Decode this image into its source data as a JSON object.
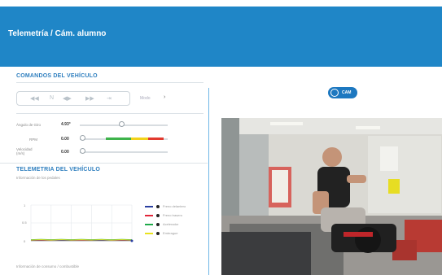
{
  "header": {
    "title": "Telemetría / Cám. alumno"
  },
  "commands": {
    "title": "COMANDOS DEL VEHÍCULO",
    "controls": [
      "◀◀",
      "N",
      "◀▶",
      "▶▶",
      "⇥"
    ],
    "mode_label": "Modo",
    "mode_arrow": "›",
    "rows": [
      {
        "label": "Ángulo de Giro",
        "value": "4.93°",
        "level": 0.48
      },
      {
        "label": "RPM",
        "value": "0.00",
        "level": 0.0
      },
      {
        "label": "Velocidad (m/s)",
        "value": "0.00",
        "level": 0.0
      }
    ],
    "rpm_bands": [
      {
        "color": "#3db34a",
        "from": 0.3,
        "to": 0.58
      },
      {
        "color": "#f2d21a",
        "from": 0.58,
        "to": 0.78
      },
      {
        "color": "#e23a2e",
        "from": 0.78,
        "to": 0.95
      }
    ]
  },
  "telemetry": {
    "title": "TELEMETRIA DEL VEHÍCULO",
    "subtitle": "Información de los pedales",
    "footer": "Información de consumo / combustible",
    "chart_data": {
      "type": "line",
      "title": "",
      "xlabel": "",
      "ylabel": "",
      "yticks": [
        "1",
        "0.5",
        "0"
      ],
      "ylim": [
        0,
        1
      ],
      "x": [
        0,
        1,
        2,
        3,
        4,
        5,
        6,
        7,
        8,
        9,
        10
      ],
      "series": [
        {
          "name": "Freno delantero",
          "color": "#2a3fa0",
          "values": [
            0.01,
            0.01,
            0.02,
            0.01,
            0.01,
            0.02,
            0.01,
            0.01,
            0.02,
            0.01,
            0.01
          ]
        },
        {
          "name": "Freno trasero",
          "color": "#e2263a",
          "values": [
            0.02,
            0.02,
            0.02,
            0.03,
            0.02,
            0.02,
            0.02,
            0.03,
            0.02,
            0.02,
            0.02
          ]
        },
        {
          "name": "Acelerador",
          "color": "#1faa4a",
          "values": [
            0.03,
            0.04,
            0.03,
            0.04,
            0.03,
            0.04,
            0.03,
            0.04,
            0.03,
            0.04,
            0.03
          ]
        },
        {
          "name": "Embrague",
          "color": "#e9e21e",
          "values": [
            0.02,
            0.03,
            0.02,
            0.03,
            0.02,
            0.03,
            0.02,
            0.03,
            0.02,
            0.03,
            0.02
          ]
        }
      ]
    }
  },
  "camera": {
    "button_label": "CAM"
  }
}
